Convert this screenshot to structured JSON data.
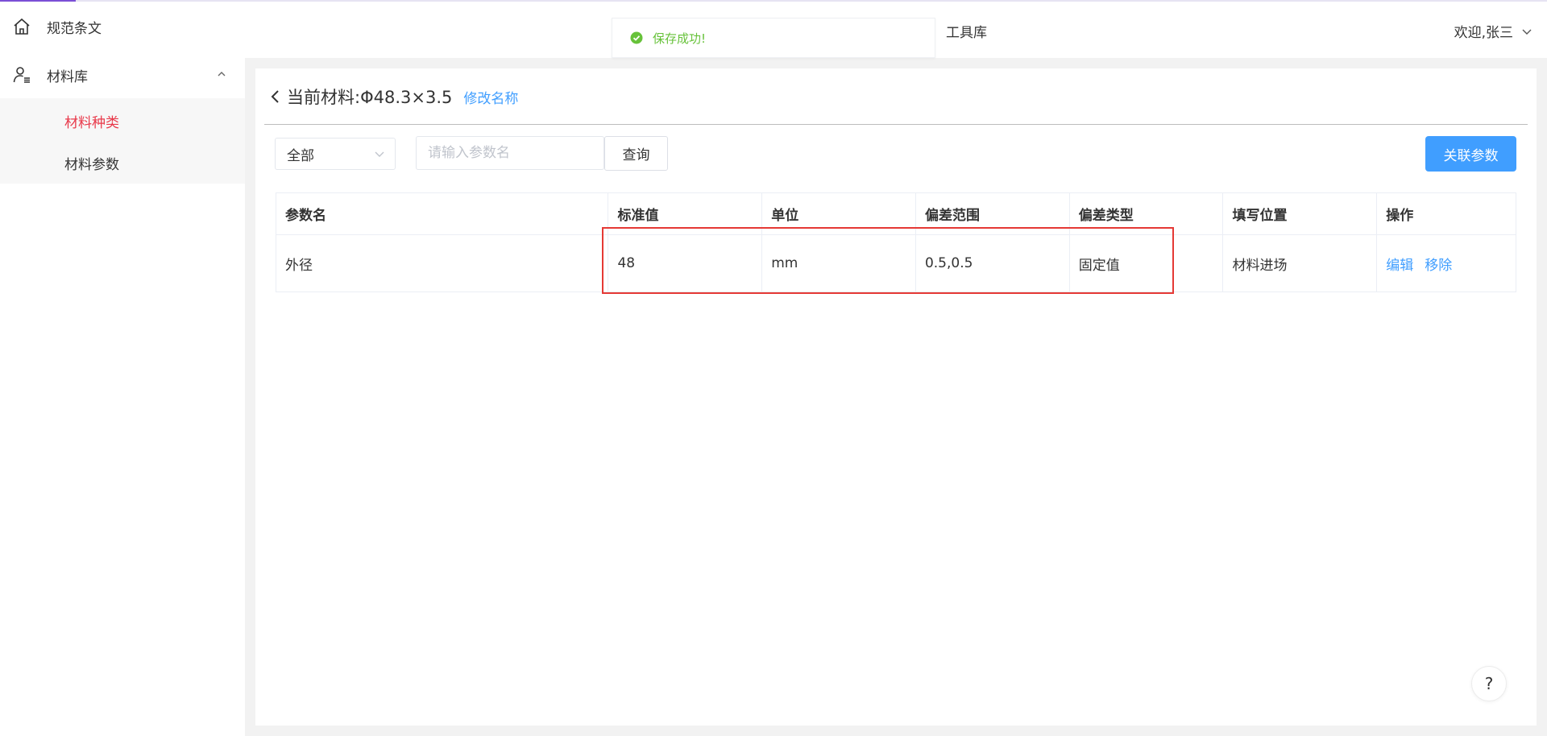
{
  "sidebar": {
    "items": [
      {
        "label": "规范条文",
        "icon": "home-icon"
      },
      {
        "label": "材料库",
        "icon": "user-list-icon",
        "expanded": true,
        "children": [
          {
            "label": "材料种类",
            "active": true
          },
          {
            "label": "材料参数",
            "active": false
          }
        ]
      }
    ]
  },
  "header": {
    "tool_label": "工具库",
    "user_label": "欢迎,张三"
  },
  "toast": {
    "text": "保存成功!",
    "color": "#67c23a"
  },
  "page": {
    "title": "当前材料:Φ48.3×3.5",
    "rename_link": "修改名称"
  },
  "filters": {
    "select_value": "全部",
    "search_placeholder": "请输入参数名",
    "query_label": "查询",
    "link_button_label": "关联参数"
  },
  "table": {
    "headers": [
      "参数名",
      "标准值",
      "单位",
      "偏差范围",
      "偏差类型",
      "填写位置",
      "操作"
    ],
    "rows": [
      {
        "name": "外径",
        "standard": "48",
        "unit": "mm",
        "range": "0.5,0.5",
        "type": "固定值",
        "position": "材料进场",
        "actions": [
          "编辑",
          "移除"
        ]
      }
    ]
  },
  "help": {
    "label": "?"
  },
  "colors": {
    "accent": "#409eff",
    "active_menu": "#e8394a",
    "highlight": "#e53935"
  }
}
